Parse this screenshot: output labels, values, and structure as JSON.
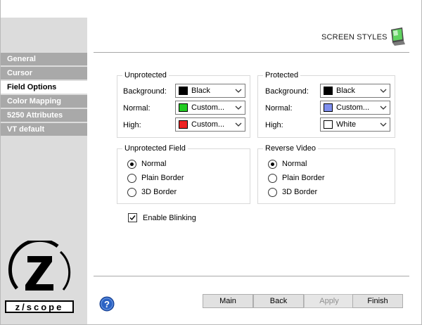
{
  "header": {
    "title": "SCREEN STYLES",
    "icon": "monitor-icon"
  },
  "sidebar": {
    "items": [
      {
        "label": "General",
        "active": false
      },
      {
        "label": "Cursor",
        "active": false
      },
      {
        "label": "Field Options",
        "active": true
      },
      {
        "label": "Color Mapping",
        "active": false
      },
      {
        "label": "5250 Attributes",
        "active": false
      },
      {
        "label": "VT default",
        "active": false
      }
    ],
    "logo_text": "Z scope"
  },
  "unprotected": {
    "title": "Unprotected",
    "rows": [
      {
        "label": "Background:",
        "value": "Black",
        "color": "#000000"
      },
      {
        "label": "Normal:",
        "value": "Custom...",
        "color": "#22cc22"
      },
      {
        "label": "High:",
        "value": "Custom...",
        "color": "#ee2222"
      }
    ]
  },
  "protected": {
    "title": "Protected",
    "rows": [
      {
        "label": "Background:",
        "value": "Black",
        "color": "#000000"
      },
      {
        "label": "Normal:",
        "value": "Custom...",
        "color": "#7f8fee"
      },
      {
        "label": "High:",
        "value": "White",
        "color": "#ffffff"
      }
    ]
  },
  "unprotected_field": {
    "title": "Unprotected Field",
    "options": [
      "Normal",
      "Plain Border",
      "3D Border"
    ],
    "selected": "Normal"
  },
  "reverse_video": {
    "title": "Reverse Video",
    "options": [
      "Normal",
      "Plain Border",
      "3D Border"
    ],
    "selected": "Normal"
  },
  "blinking": {
    "label": "Enable Blinking",
    "checked": true
  },
  "buttons": {
    "main": "Main",
    "back": "Back",
    "apply": "Apply",
    "finish": "Finish"
  },
  "colors": {
    "sidebar_bg": "#dcdcdc",
    "nav_bg": "#a9a9a9",
    "help_blue": "#2a62c4"
  }
}
